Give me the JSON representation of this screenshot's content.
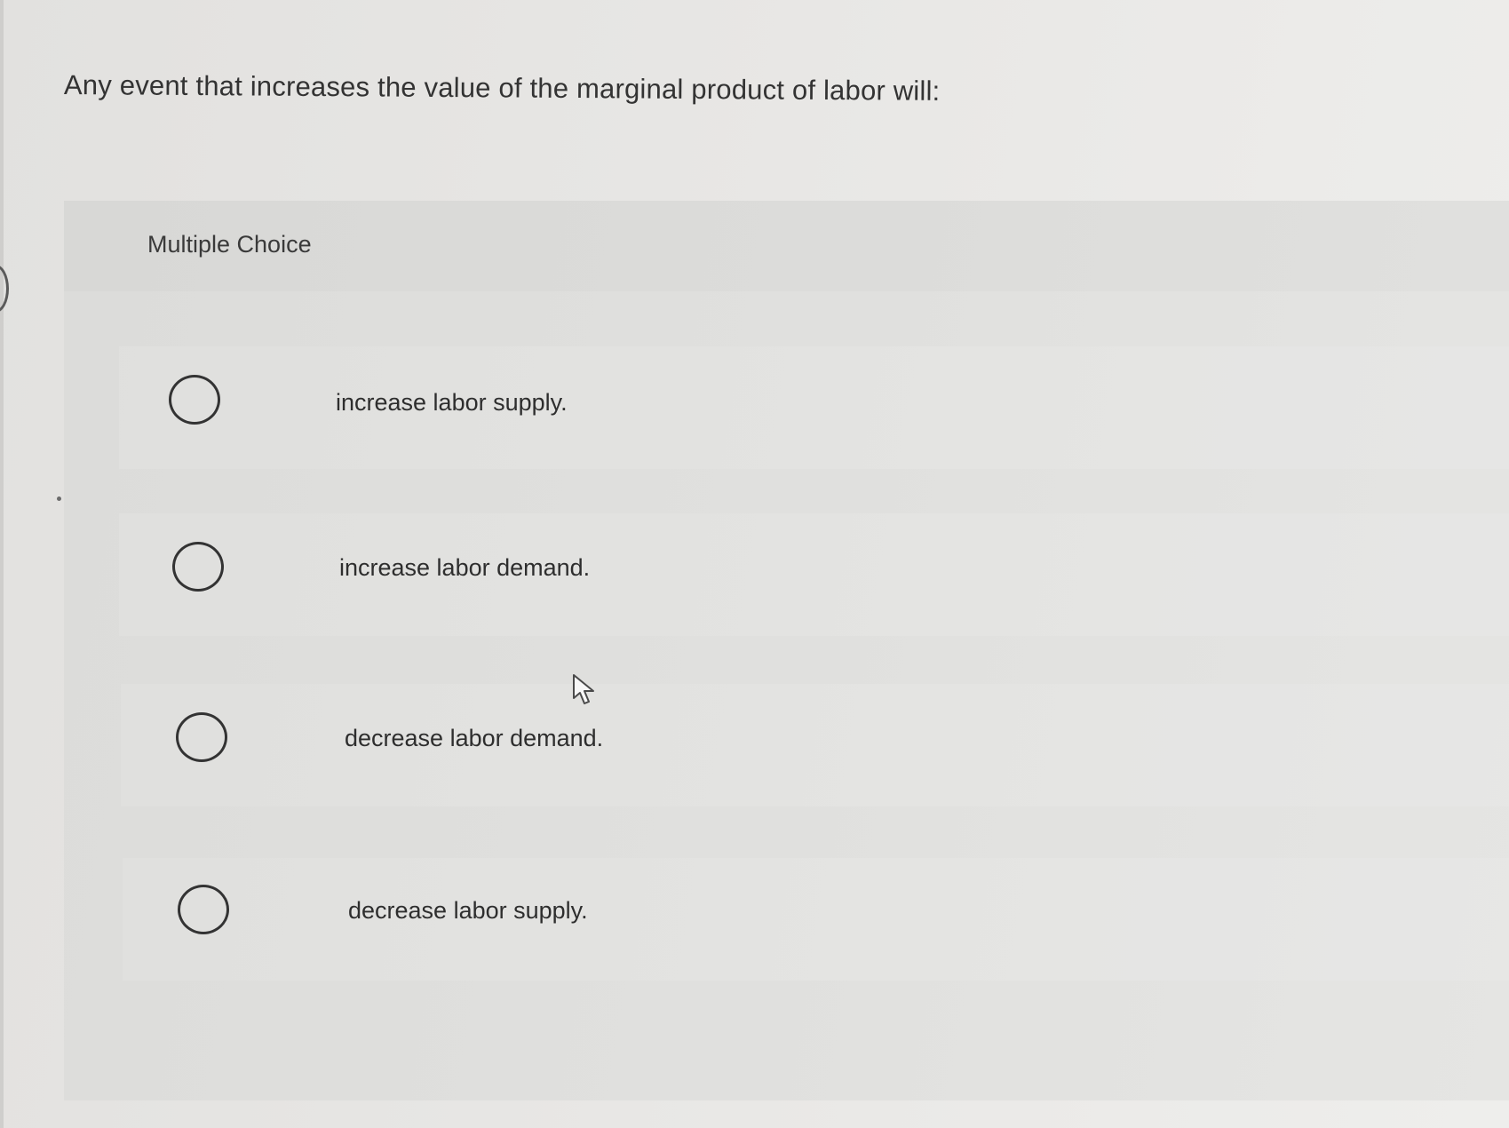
{
  "question": {
    "text": "Any event that increases the value of the marginal product of labor will:"
  },
  "choice_panel": {
    "label": "Multiple Choice",
    "options": [
      {
        "label": "increase labor supply.",
        "selected": false
      },
      {
        "label": "increase labor demand.",
        "selected": false
      },
      {
        "label": "decrease labor demand.",
        "selected": false
      },
      {
        "label": "decrease labor supply.",
        "selected": false
      }
    ]
  },
  "icons": {
    "radio": "radio-button-icon",
    "cursor": "mouse-pointer-icon"
  },
  "colors": {
    "background": "#e6e5e3",
    "panel": "#dfdfdd",
    "text": "#2f2f2f",
    "radio_border": "#333333"
  }
}
